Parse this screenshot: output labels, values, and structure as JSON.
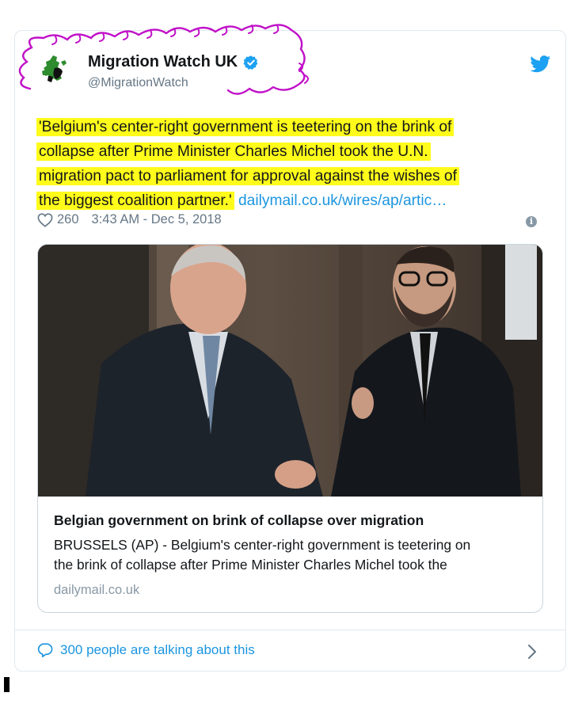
{
  "tweet": {
    "display_name": "Migration Watch UK",
    "handle": "@MigrationWatch",
    "text_lines": [
      "'Belgium's center-right government is teetering on the brink of",
      "collapse after Prime Minister Charles Michel took the U.N.",
      "migration pact to parliament for approval against the wishes of",
      "the biggest coalition partner.'"
    ],
    "link": "dailymail.co.uk/wires/ap/artic…",
    "likes": "260",
    "timestamp": "3:43 AM - Dec 5, 2018"
  },
  "media_card": {
    "title": "Belgian government on brink of collapse over migration",
    "description_lines": [
      "BRUSSELS (AP) - Belgium's center-right government is teetering on",
      "the brink of collapse after Prime Minister Charles Michel took the"
    ],
    "domain": "dailymail.co.uk"
  },
  "footer": {
    "talking": "300 people are talking about this"
  },
  "icons": {
    "verified": "verified-badge-icon",
    "bird": "twitter-bird-icon",
    "heart": "heart-icon",
    "info": "info-icon",
    "reply": "speech-bubble-icon",
    "chevron": "chevron-right-icon"
  },
  "colors": {
    "accent": "#1b95e0",
    "highlight": "#fffb1a",
    "annotation": "#c010c8",
    "muted": "#657786",
    "border": "#e1e8ed"
  }
}
